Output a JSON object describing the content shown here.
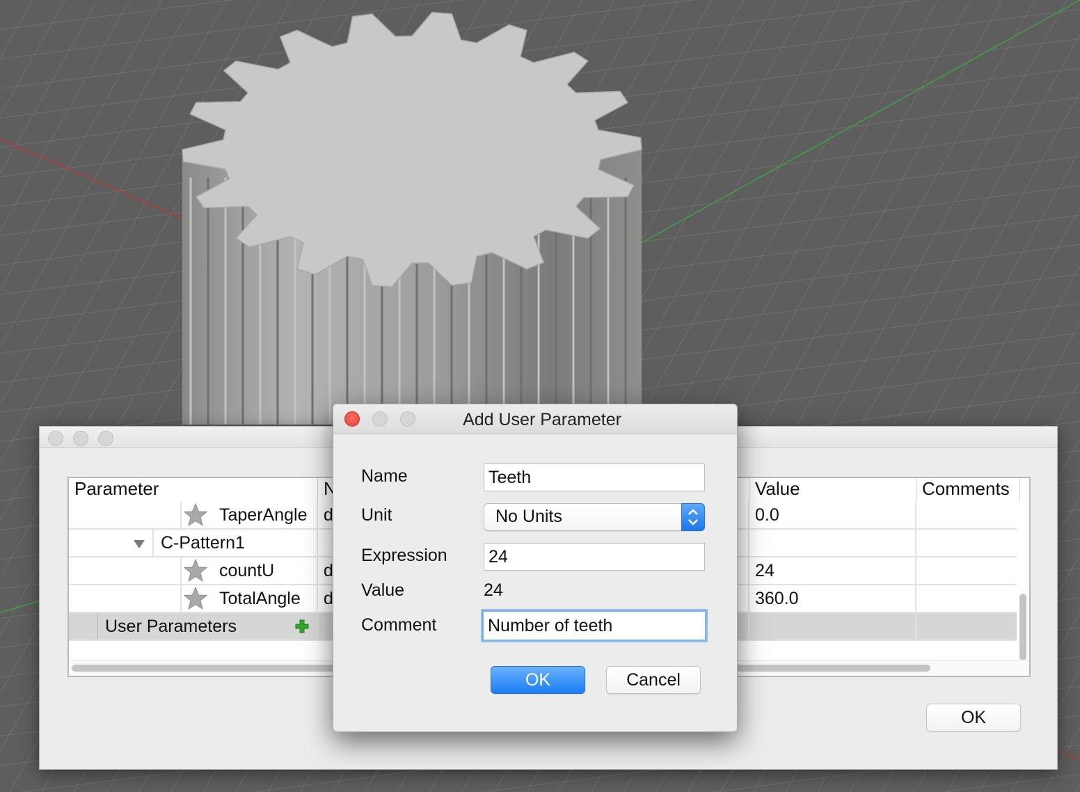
{
  "parameters_window": {
    "columns": [
      "Parameter",
      "N",
      "Value",
      "Comments"
    ],
    "rows": [
      {
        "name": "TaperAngle",
        "n": "d",
        "value": "0.0",
        "comments": ""
      },
      {
        "name": "C-Pattern1",
        "n": "",
        "value": "",
        "comments": ""
      },
      {
        "name": "countU",
        "n": "d",
        "value": "24",
        "comments": ""
      },
      {
        "name": "TotalAngle",
        "n": "d",
        "value": "360.0",
        "comments": ""
      },
      {
        "name": "User Parameters",
        "n": "",
        "value": "",
        "comments": ""
      }
    ],
    "ok_label": "OK"
  },
  "dialog": {
    "title": "Add User Parameter",
    "name_label": "Name",
    "name_value": "Teeth",
    "unit_label": "Unit",
    "unit_value": "No Units",
    "expression_label": "Expression",
    "expression_value": "24",
    "value_label": "Value",
    "value_readout": "24",
    "comment_label": "Comment",
    "comment_value": "Number of teeth",
    "ok_label": "OK",
    "cancel_label": "Cancel"
  },
  "colors": {
    "accent_blue": "#1b7ff4",
    "add_icon_green": "#2fa82f",
    "close_red": "#ff5f57",
    "viewport_background": "#5e5e5e",
    "gear_surface": "#c8c8c6"
  },
  "icons": {
    "favorite": "star-icon",
    "expand": "triangle-down-icon",
    "add": "plus-icon",
    "stepper": "chevron-up-down-icon"
  }
}
